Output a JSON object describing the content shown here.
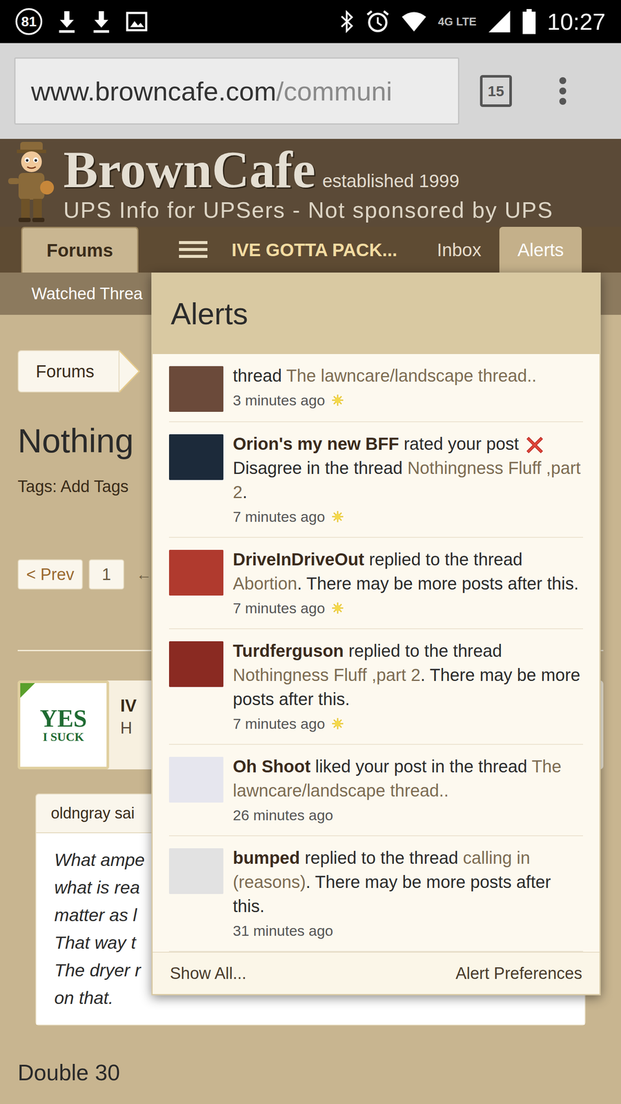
{
  "status_bar": {
    "notification_count": "81",
    "network": "4G LTE",
    "time": "10:27"
  },
  "browser": {
    "url_domain": "www.browncafe.com",
    "url_path": "/communi",
    "tab_count": "15"
  },
  "site": {
    "name": "BrownCafe",
    "established": "established 1999",
    "tagline": "UPS Info for UPSers - Not sponsored by UPS"
  },
  "nav": [
    {
      "label": "Forums",
      "selected": true,
      "open": false
    },
    {
      "label": "IVE GOTTA PACK...",
      "selected": false,
      "open": false
    },
    {
      "label": "Inbox",
      "selected": false,
      "open": false
    },
    {
      "label": "Alerts",
      "selected": false,
      "open": true
    }
  ],
  "subnav": {
    "watched": "Watched Threa"
  },
  "breadcrumb": [
    "Forums"
  ],
  "thread": {
    "title": "Nothing",
    "tags": "Tags: Add Tags"
  },
  "pagination": {
    "prev": "< Prev",
    "page": "1",
    "more": "←"
  },
  "post": {
    "author": "IV",
    "title": "H",
    "avatar_lines": [
      "YES",
      "I SUCK"
    ]
  },
  "quote": {
    "author": "oldngray sai",
    "lines": [
      "What ampe",
      "what is rea",
      "matter as l",
      "That way t",
      "The dryer r",
      "on that."
    ]
  },
  "reply": "Double 30",
  "alerts": {
    "title": "Alerts",
    "items": [
      {
        "segments": [
          {
            "kind": "text",
            "text": "thread "
          },
          {
            "kind": "thread",
            "text": "The lawncare/landscape thread.."
          }
        ],
        "time": "3 minutes ago",
        "unread": true,
        "avatar_color": "#6b4a3a"
      },
      {
        "segments": [
          {
            "kind": "user",
            "text": "Orion's my new BFF"
          },
          {
            "kind": "text",
            "text": " rated your post "
          },
          {
            "kind": "rating",
            "text": ""
          },
          {
            "kind": "text",
            "text": " Disagree in the thread "
          },
          {
            "kind": "thread",
            "text": "Nothingness Fluff ,part 2"
          },
          {
            "kind": "text",
            "text": "."
          }
        ],
        "time": "7 minutes ago",
        "unread": true,
        "avatar_color": "#1c2a3a"
      },
      {
        "segments": [
          {
            "kind": "user",
            "text": "DriveInDriveOut"
          },
          {
            "kind": "text",
            "text": " replied to the thread "
          },
          {
            "kind": "thread",
            "text": "Abortion"
          },
          {
            "kind": "text",
            "text": ". There may be more posts after this."
          }
        ],
        "time": "7 minutes ago",
        "unread": true,
        "avatar_color": "#b03a2e"
      },
      {
        "segments": [
          {
            "kind": "user",
            "text": "Turdferguson"
          },
          {
            "kind": "text",
            "text": " replied to the thread "
          },
          {
            "kind": "thread",
            "text": "Nothingness Fluff ,part 2"
          },
          {
            "kind": "text",
            "text": ". There may be more posts after this."
          }
        ],
        "time": "7 minutes ago",
        "unread": true,
        "avatar_color": "#8a2a22"
      },
      {
        "segments": [
          {
            "kind": "user",
            "text": "Oh Shoot"
          },
          {
            "kind": "text",
            "text": " liked your post in the thread "
          },
          {
            "kind": "thread",
            "text": "The lawncare/landscape thread.."
          }
        ],
        "time": "26 minutes ago",
        "unread": false,
        "avatar_color": "#e6e6ee"
      },
      {
        "segments": [
          {
            "kind": "user",
            "text": "bumped"
          },
          {
            "kind": "text",
            "text": " replied to the thread "
          },
          {
            "kind": "thread",
            "text": "calling in (reasons)"
          },
          {
            "kind": "text",
            "text": ". There may be more posts after this."
          }
        ],
        "time": "31 minutes ago",
        "unread": false,
        "avatar_color": "#e2e2e2"
      }
    ],
    "footer": {
      "show_all": "Show All...",
      "preferences": "Alert Preferences"
    }
  }
}
